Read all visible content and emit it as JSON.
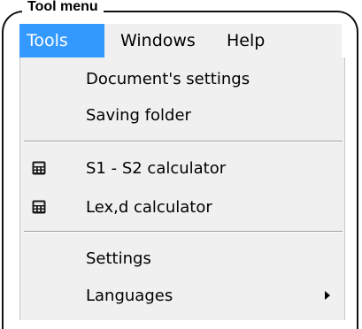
{
  "frame": {
    "title": "Tool menu"
  },
  "menubar": {
    "items": [
      {
        "label": "Tools",
        "active": true
      },
      {
        "label": "Windows",
        "active": false
      },
      {
        "label": "Help",
        "active": false
      }
    ],
    "accent_color": "#3399ff"
  },
  "dropdown": {
    "groups": [
      {
        "items": [
          {
            "label": "Document's settings",
            "icon": null,
            "submenu": false
          },
          {
            "label": "Saving folder",
            "icon": null,
            "submenu": false
          }
        ]
      },
      {
        "items": [
          {
            "label": "S1 - S2 calculator",
            "icon": "calculator-icon",
            "submenu": false
          },
          {
            "label": "Lex,d calculator",
            "icon": "calculator-icon",
            "submenu": false
          }
        ]
      },
      {
        "items": [
          {
            "label": "Settings",
            "icon": null,
            "submenu": false
          },
          {
            "label": "Languages",
            "icon": null,
            "submenu": true
          }
        ]
      }
    ]
  }
}
